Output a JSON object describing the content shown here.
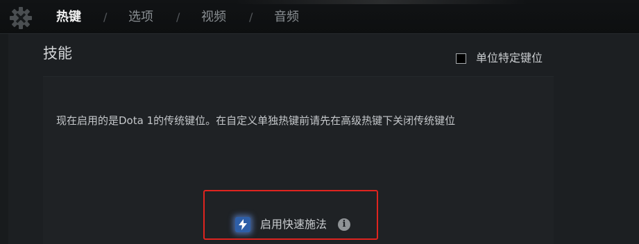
{
  "nav": {
    "tabs": [
      {
        "label": "热键",
        "active": true
      },
      {
        "label": "选项",
        "active": false
      },
      {
        "label": "视频",
        "active": false
      },
      {
        "label": "音频",
        "active": false
      }
    ],
    "separator": "/",
    "settings_icon": "gear-icon"
  },
  "section": {
    "title": "技能",
    "unit_specific_checkbox": {
      "label": "单位特定键位",
      "checked": false
    },
    "notice": "现在启用的是Dota 1的传统键位。在自定义单独热键前请先在高级热键下关闭传统键位",
    "quickcast": {
      "label": "启用快速施法",
      "icon": "lightning-bolt-icon",
      "info_icon": "info-icon",
      "info_glyph": "i"
    }
  },
  "colors": {
    "highlight_border": "#e0241f",
    "bolt_background": "#2e5fa8",
    "active_tab": "#f2f2f2",
    "inactive_tab": "#8a8f93"
  }
}
